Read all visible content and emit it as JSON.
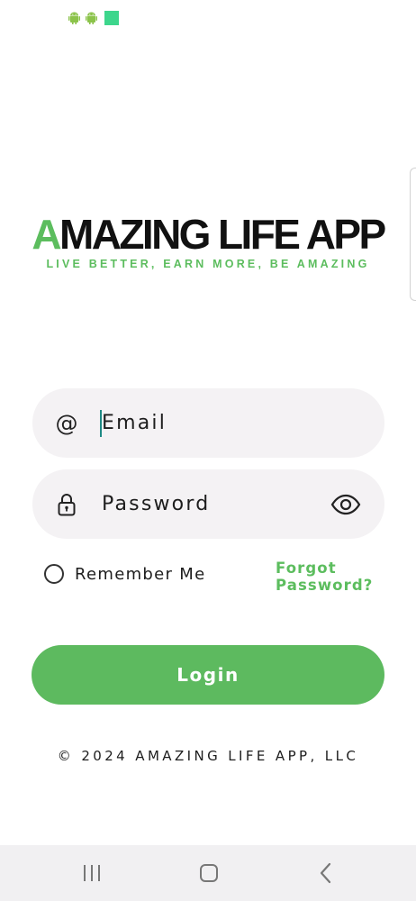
{
  "status_bar": {
    "icons": [
      "android-icon",
      "android-icon",
      "notification-square-icon"
    ]
  },
  "logo": {
    "first_letter": "A",
    "title_rest": "MAZING LIFE APP",
    "tagline": "LIVE BETTER, EARN MORE, BE AMAZING"
  },
  "form": {
    "email": {
      "icon": "at-icon",
      "placeholder": "Email",
      "value": ""
    },
    "password": {
      "icon": "lock-icon",
      "placeholder": "Password",
      "value": "",
      "toggle_icon": "eye-icon"
    },
    "remember_label": "Remember Me",
    "remember_checked": false,
    "forgot_line1": "Forgot",
    "forgot_line2": "Password?",
    "login_label": "Login"
  },
  "footer": {
    "copyright": "© 2024 AMAZING LIFE APP, LLC"
  },
  "nav_bar": {
    "buttons": [
      "recent-apps-icon",
      "home-icon",
      "back-icon"
    ]
  },
  "colors": {
    "accent": "#5cbd5e",
    "field_background": "#f4f2f4",
    "caret": "#1f8a85",
    "nav_background": "#f1f0f2"
  }
}
